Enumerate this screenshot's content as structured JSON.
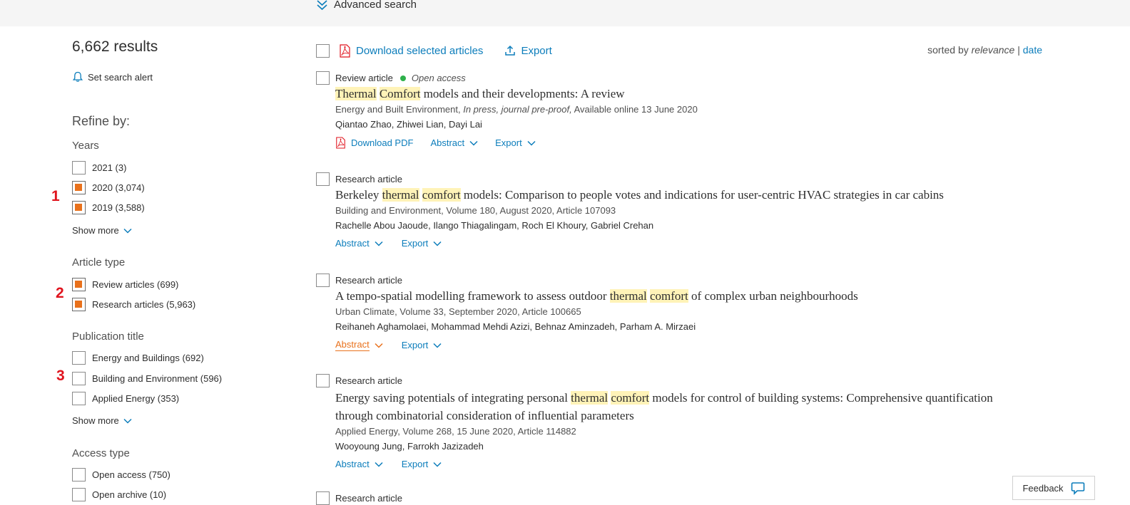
{
  "advanced_search": "Advanced search",
  "results_count": "6,662 results",
  "set_alert": "Set search alert",
  "refine_by": "Refine by:",
  "annotations": [
    "1",
    "2",
    "3"
  ],
  "facets": {
    "years": {
      "title": "Years",
      "items": [
        {
          "label": "2021 (3)",
          "checked": false
        },
        {
          "label": "2020 (3,074)",
          "checked": true
        },
        {
          "label": "2019 (3,588)",
          "checked": true
        }
      ],
      "show_more": "Show more"
    },
    "article_type": {
      "title": "Article type",
      "items": [
        {
          "label": "Review articles (699)",
          "checked": true
        },
        {
          "label": "Research articles (5,963)",
          "checked": true
        }
      ]
    },
    "publication_title": {
      "title": "Publication title",
      "items": [
        {
          "label": "Energy and Buildings (692)",
          "checked": false
        },
        {
          "label": "Building and Environment (596)",
          "checked": false
        },
        {
          "label": "Applied Energy (353)",
          "checked": false
        }
      ],
      "show_more": "Show more"
    },
    "access_type": {
      "title": "Access type",
      "items": [
        {
          "label": "Open access (750)",
          "checked": false
        },
        {
          "label": "Open archive (10)",
          "checked": false
        }
      ]
    }
  },
  "toolbar": {
    "download_selected": "Download selected articles",
    "export": "Export",
    "sorted_by": "sorted by",
    "relevance": "relevance",
    "separator": "|",
    "date": "date"
  },
  "articles": [
    {
      "type": "Review article",
      "open_access": "Open access",
      "title_parts": [
        [
          "Thermal",
          true
        ],
        [
          " ",
          false
        ],
        [
          "Comfort",
          true
        ],
        [
          " models and their developments: A review",
          false
        ]
      ],
      "source": "Energy and Built Environment, ",
      "source_italic": "In press, journal pre-proof,",
      "source_rest": " Available online 13 June 2020",
      "authors": "Qiantao Zhao, Zhiwei Lian, Dayi Lai",
      "download_pdf": "Download PDF",
      "abstract": "Abstract",
      "export": "Export"
    },
    {
      "type": "Research article",
      "title_parts": [
        [
          "Berkeley ",
          false
        ],
        [
          "thermal",
          true
        ],
        [
          " ",
          false
        ],
        [
          "comfort",
          true
        ],
        [
          " models: Comparison to people votes and indications for user-centric HVAC strategies in car cabins",
          false
        ]
      ],
      "source": "Building and Environment, Volume 180, August 2020, Article 107093",
      "authors": "Rachelle Abou Jaoude, Ilango Thiagalingam, Roch El Khoury, Gabriel Crehan",
      "abstract": "Abstract",
      "export": "Export"
    },
    {
      "type": "Research article",
      "title_parts": [
        [
          "A tempo-spatial modelling framework to assess outdoor ",
          false
        ],
        [
          "thermal",
          true
        ],
        [
          " ",
          false
        ],
        [
          "comfort",
          true
        ],
        [
          " of complex urban neighbourhoods",
          false
        ]
      ],
      "source": "Urban Climate, Volume 33, September 2020, Article 100665",
      "authors": "Reihaneh Aghamolaei, Mohammad Mehdi Azizi, Behnaz Aminzadeh, Parham A. Mirzaei",
      "abstract": "Abstract",
      "export": "Export"
    },
    {
      "type": "Research article",
      "title_parts": [
        [
          "Energy saving potentials of integrating personal ",
          false
        ],
        [
          "thermal",
          true
        ],
        [
          " ",
          false
        ],
        [
          "comfort",
          true
        ],
        [
          " models for control of building systems: Comprehensive quantification through combinatorial consideration of influential parameters",
          false
        ]
      ],
      "source": "Applied Energy, Volume 268, 15 June 2020, Article 114882",
      "authors": "Wooyoung Jung, Farrokh Jazizadeh",
      "abstract": "Abstract",
      "export": "Export"
    },
    {
      "type": "Research article"
    }
  ],
  "feedback": "Feedback",
  "colors": {
    "accent_link": "#0c7dbb",
    "checked_orange": "#e9711c",
    "highlight": "#fff3b8",
    "annotation_red": "#e0141e",
    "open_access_green": "#2eb04b"
  }
}
